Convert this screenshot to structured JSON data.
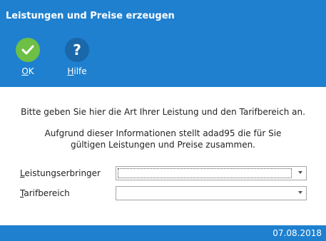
{
  "window": {
    "title": "Leistungen und Preise erzeugen"
  },
  "toolbar": {
    "ok_label_accel": "O",
    "ok_label_rest": "K",
    "help_label_accel": "H",
    "help_label_rest": "ilfe"
  },
  "content": {
    "message_line1": "Bitte geben Sie hier die Art Ihrer Leistung und den Tarifbereich an.",
    "message_line2": "Aufgrund dieser Informationen stellt adad95 die für Sie gültigen Leistungen und Preise zusammen.",
    "fields": [
      {
        "label_accel": "L",
        "label_rest": "eistungserbringer",
        "value": ""
      },
      {
        "label_accel": "T",
        "label_rest": "arifbereich",
        "value": ""
      }
    ]
  },
  "status": {
    "date": "07.08.2018"
  },
  "colors": {
    "accent": "#1e80cf",
    "ok_green": "#6dbf45",
    "help_blue": "#1a67aa"
  }
}
